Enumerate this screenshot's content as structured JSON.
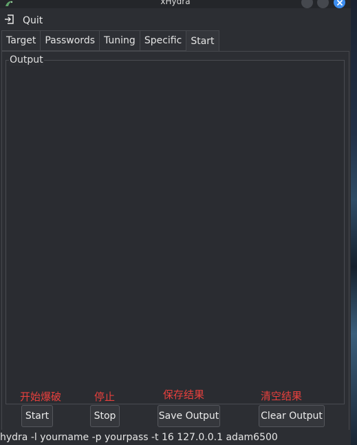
{
  "window": {
    "title": "xHydra"
  },
  "menu": {
    "quit_label": "Quit",
    "quit_icon": "logout-icon"
  },
  "tabs": [
    {
      "label": "Target",
      "active": false
    },
    {
      "label": "Passwords",
      "active": false
    },
    {
      "label": "Tuning",
      "active": false
    },
    {
      "label": "Specific",
      "active": false
    },
    {
      "label": "Start",
      "active": true
    }
  ],
  "output": {
    "group_label": "Output",
    "content": ""
  },
  "annotations": {
    "start": "开始爆破",
    "stop": "停止",
    "save": "保存结果",
    "clear": "清空结果",
    "color": "#e8403d"
  },
  "buttons": {
    "start": "Start",
    "stop": "Stop",
    "save_output": "Save Output",
    "clear_output": "Clear Output"
  },
  "status": {
    "command": "hydra -l yourname -p yourpass -t 16 127.0.0.1 adam6500"
  },
  "colors": {
    "window_bg": "#2c2e33",
    "close_button": "#3d8ef0"
  }
}
